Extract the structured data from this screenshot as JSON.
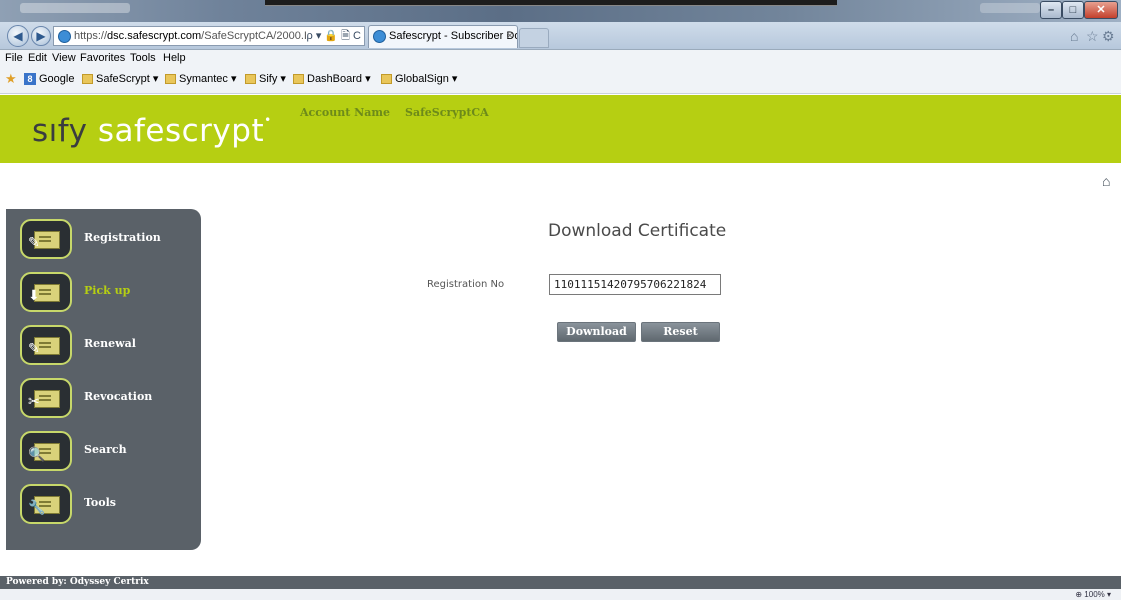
{
  "browser": {
    "address_prefix": "https://",
    "address_domain": "dsc.safescrypt.com",
    "address_path": "/SafeScryptCA/2000.I",
    "address_tools": "ρ ▾ 🔒 🗎 C",
    "tab_title": "Safescrypt - Subscriber Do...",
    "tab_close": "×",
    "back_glyph": "◀",
    "forward_glyph": "▶"
  },
  "menubar": {
    "items": [
      "File",
      "Edit",
      "View",
      "Favorites",
      "Tools",
      "Help"
    ]
  },
  "favorites": {
    "items": [
      "Google",
      "SafeScrypt ▾",
      "Symantec ▾",
      "Sify ▾",
      "DashBoard ▾",
      "GlobalSign ▾"
    ]
  },
  "header": {
    "logo_sify": "sıfy",
    "logo_safescrypt": "safescrypt",
    "logo_mark": "•",
    "account_label": "Account Name",
    "account_value": "SafeScryptCA"
  },
  "sidebar": {
    "items": [
      {
        "label": "Registration",
        "icon": "certificate-pen-icon",
        "glyph": "✎",
        "active": false
      },
      {
        "label": "Pick up",
        "icon": "certificate-download-icon",
        "glyph": "⬇",
        "active": true
      },
      {
        "label": "Renewal",
        "icon": "certificate-renew-icon",
        "glyph": "✎",
        "active": false
      },
      {
        "label": "Revocation",
        "icon": "certificate-revoke-icon",
        "glyph": "✂",
        "active": false
      },
      {
        "label": "Search",
        "icon": "certificate-search-icon",
        "glyph": "🔍",
        "active": false
      },
      {
        "label": "Tools",
        "icon": "certificate-tools-icon",
        "glyph": "🔧",
        "active": false
      }
    ]
  },
  "main": {
    "title": "Download Certificate",
    "registration_label": "Registration No",
    "registration_value": "11011151420795706221824",
    "download_label": "Download",
    "reset_label": "Reset",
    "home_glyph": "⌂"
  },
  "footer": {
    "powered_by": "Powered by: Odyssey Certrix"
  },
  "statusbar": {
    "zoom": "⊕ 100%  ▾"
  },
  "colors": {
    "header_bg": "#b6cf12",
    "sidebar_bg": "#5a6168",
    "active_nav": "#b6cf12"
  }
}
